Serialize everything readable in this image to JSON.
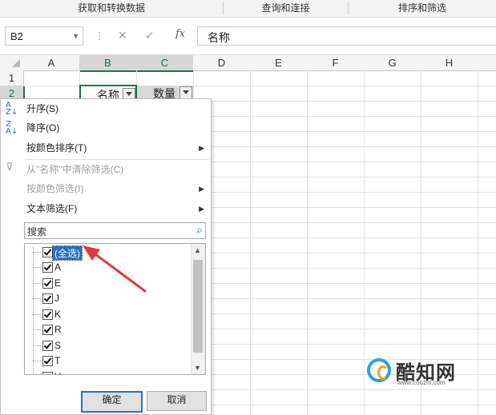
{
  "ribbon": {
    "groups": [
      "获取和转换数据",
      "查询和连接",
      "排序和筛选"
    ]
  },
  "formula_bar": {
    "name_box": "B2",
    "cancel_icon": "✕",
    "enter_icon": "✓",
    "fx_label": "fx",
    "formula": "名称"
  },
  "sheet": {
    "columns": [
      "A",
      "B",
      "C",
      "D",
      "E",
      "F",
      "G",
      "H"
    ],
    "selected_columns": [
      "B",
      "C"
    ],
    "rows": [
      "1",
      "2"
    ],
    "selected_row": "2",
    "cells": {
      "B2": "名称",
      "C2": "数量"
    }
  },
  "filter_menu": {
    "sort_asc": "升序(S)",
    "sort_desc": "降序(O)",
    "sort_by_color": "按颜色排序(T)",
    "clear_filter": "从\"名称\"中清除筛选(C)",
    "filter_by_color": "按颜色筛选(I)",
    "text_filter": "文本筛选(F)",
    "search_placeholder": "搜索",
    "items": [
      {
        "label": "(全选)",
        "checked": true,
        "highlighted": true
      },
      {
        "label": "A",
        "checked": true
      },
      {
        "label": "E",
        "checked": true
      },
      {
        "label": "J",
        "checked": true
      },
      {
        "label": "K",
        "checked": true
      },
      {
        "label": "R",
        "checked": true
      },
      {
        "label": "S",
        "checked": true
      },
      {
        "label": "T",
        "checked": true
      },
      {
        "label": "V",
        "checked": true
      }
    ],
    "ok_label": "确定",
    "cancel_label": "取消"
  },
  "watermark": {
    "name": "酷知网",
    "url": "www.coozhi.com"
  },
  "colors": {
    "accent_green": "#217346",
    "highlight_blue": "#2a6fc9",
    "arrow_red": "#e23b3b"
  }
}
